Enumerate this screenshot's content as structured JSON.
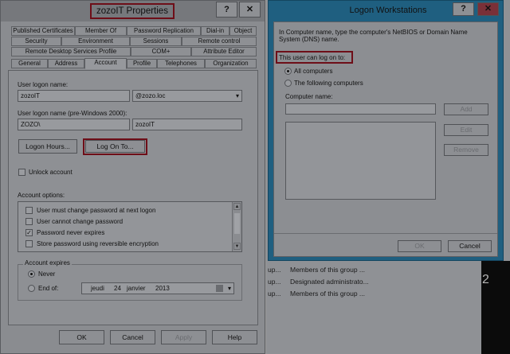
{
  "props": {
    "title": "zozoIT Properties",
    "help_btn": "?",
    "close_btn": "✕",
    "tabs_row1": [
      "Published Certificates",
      "Member Of",
      "Password Replication",
      "Dial-in",
      "Object"
    ],
    "tabs_row2": [
      "Security",
      "Environment",
      "Sessions",
      "Remote control"
    ],
    "tabs_row3": [
      "Remote Desktop Services Profile",
      "COM+",
      "Attribute Editor"
    ],
    "tabs_row4": [
      "General",
      "Address",
      "Account",
      "Profile",
      "Telephones",
      "Organization"
    ],
    "user_logon_label": "User logon name:",
    "user_logon_value": "zozoIT",
    "domain_value": "@zozo.loc",
    "pre2000_label": "User logon name (pre-Windows 2000):",
    "pre2000_domain": "ZOZO\\",
    "pre2000_user": "zozoIT",
    "logon_hours": "Logon Hours...",
    "log_on_to": "Log On To...",
    "unlock_account": "Unlock account",
    "account_options_label": "Account options:",
    "options": [
      {
        "label": "User must change password at next logon",
        "checked": false
      },
      {
        "label": "User cannot change password",
        "checked": false
      },
      {
        "label": "Password never expires",
        "checked": true
      },
      {
        "label": "Store password using reversible encryption",
        "checked": false
      }
    ],
    "account_expires_label": "Account expires",
    "never": "Never",
    "end_of": "End of:",
    "date_day": "jeudi",
    "date_num": "24",
    "date_month": "janvier",
    "date_year": "2013",
    "ok": "OK",
    "cancel": "Cancel",
    "apply": "Apply",
    "help": "Help"
  },
  "logon": {
    "title": "Logon Workstations",
    "help_btn": "?",
    "close_btn": "✕",
    "intro": "In Computer name, type the computer's NetBIOS or Domain Name System (DNS) name.",
    "can_log_on": "This user can log on to:",
    "all_computers": "All computers",
    "following_computers": "The following computers",
    "computer_name_label": "Computer name:",
    "add": "Add",
    "edit": "Edit",
    "remove": "Remove",
    "ok": "OK",
    "cancel": "Cancel"
  },
  "background": {
    "rows": [
      {
        "col1": "up...",
        "col2": "Members of this group ..."
      },
      {
        "col1": "up...",
        "col2": "Designated administrato..."
      },
      {
        "col1": "up...",
        "col2": "Members of this group ..."
      }
    ],
    "number": "2"
  }
}
